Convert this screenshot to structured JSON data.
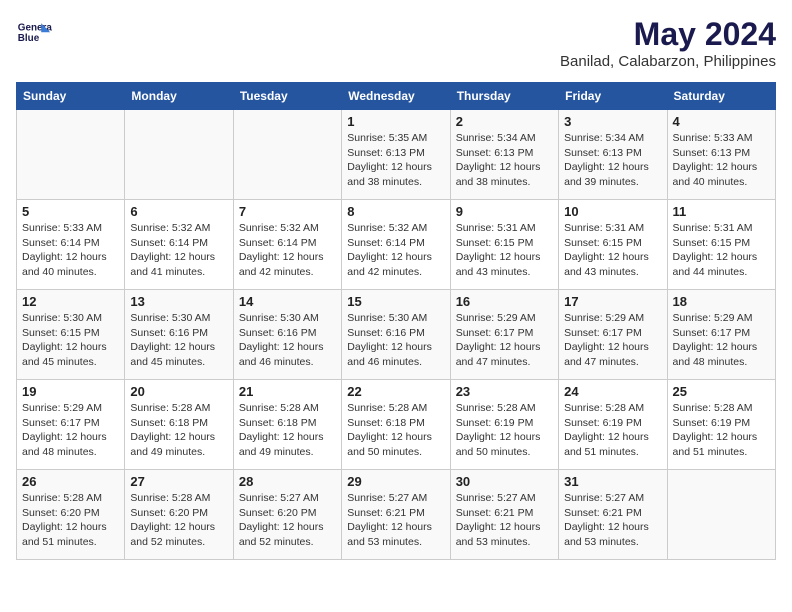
{
  "logo": {
    "line1": "General",
    "line2": "Blue"
  },
  "title": "May 2024",
  "subtitle": "Banilad, Calabarzon, Philippines",
  "columns": [
    "Sunday",
    "Monday",
    "Tuesday",
    "Wednesday",
    "Thursday",
    "Friday",
    "Saturday"
  ],
  "weeks": [
    [
      {
        "day": "",
        "info": ""
      },
      {
        "day": "",
        "info": ""
      },
      {
        "day": "",
        "info": ""
      },
      {
        "day": "1",
        "info": "Sunrise: 5:35 AM\nSunset: 6:13 PM\nDaylight: 12 hours\nand 38 minutes."
      },
      {
        "day": "2",
        "info": "Sunrise: 5:34 AM\nSunset: 6:13 PM\nDaylight: 12 hours\nand 38 minutes."
      },
      {
        "day": "3",
        "info": "Sunrise: 5:34 AM\nSunset: 6:13 PM\nDaylight: 12 hours\nand 39 minutes."
      },
      {
        "day": "4",
        "info": "Sunrise: 5:33 AM\nSunset: 6:13 PM\nDaylight: 12 hours\nand 40 minutes."
      }
    ],
    [
      {
        "day": "5",
        "info": "Sunrise: 5:33 AM\nSunset: 6:14 PM\nDaylight: 12 hours\nand 40 minutes."
      },
      {
        "day": "6",
        "info": "Sunrise: 5:32 AM\nSunset: 6:14 PM\nDaylight: 12 hours\nand 41 minutes."
      },
      {
        "day": "7",
        "info": "Sunrise: 5:32 AM\nSunset: 6:14 PM\nDaylight: 12 hours\nand 42 minutes."
      },
      {
        "day": "8",
        "info": "Sunrise: 5:32 AM\nSunset: 6:14 PM\nDaylight: 12 hours\nand 42 minutes."
      },
      {
        "day": "9",
        "info": "Sunrise: 5:31 AM\nSunset: 6:15 PM\nDaylight: 12 hours\nand 43 minutes."
      },
      {
        "day": "10",
        "info": "Sunrise: 5:31 AM\nSunset: 6:15 PM\nDaylight: 12 hours\nand 43 minutes."
      },
      {
        "day": "11",
        "info": "Sunrise: 5:31 AM\nSunset: 6:15 PM\nDaylight: 12 hours\nand 44 minutes."
      }
    ],
    [
      {
        "day": "12",
        "info": "Sunrise: 5:30 AM\nSunset: 6:15 PM\nDaylight: 12 hours\nand 45 minutes."
      },
      {
        "day": "13",
        "info": "Sunrise: 5:30 AM\nSunset: 6:16 PM\nDaylight: 12 hours\nand 45 minutes."
      },
      {
        "day": "14",
        "info": "Sunrise: 5:30 AM\nSunset: 6:16 PM\nDaylight: 12 hours\nand 46 minutes."
      },
      {
        "day": "15",
        "info": "Sunrise: 5:30 AM\nSunset: 6:16 PM\nDaylight: 12 hours\nand 46 minutes."
      },
      {
        "day": "16",
        "info": "Sunrise: 5:29 AM\nSunset: 6:17 PM\nDaylight: 12 hours\nand 47 minutes."
      },
      {
        "day": "17",
        "info": "Sunrise: 5:29 AM\nSunset: 6:17 PM\nDaylight: 12 hours\nand 47 minutes."
      },
      {
        "day": "18",
        "info": "Sunrise: 5:29 AM\nSunset: 6:17 PM\nDaylight: 12 hours\nand 48 minutes."
      }
    ],
    [
      {
        "day": "19",
        "info": "Sunrise: 5:29 AM\nSunset: 6:17 PM\nDaylight: 12 hours\nand 48 minutes."
      },
      {
        "day": "20",
        "info": "Sunrise: 5:28 AM\nSunset: 6:18 PM\nDaylight: 12 hours\nand 49 minutes."
      },
      {
        "day": "21",
        "info": "Sunrise: 5:28 AM\nSunset: 6:18 PM\nDaylight: 12 hours\nand 49 minutes."
      },
      {
        "day": "22",
        "info": "Sunrise: 5:28 AM\nSunset: 6:18 PM\nDaylight: 12 hours\nand 50 minutes."
      },
      {
        "day": "23",
        "info": "Sunrise: 5:28 AM\nSunset: 6:19 PM\nDaylight: 12 hours\nand 50 minutes."
      },
      {
        "day": "24",
        "info": "Sunrise: 5:28 AM\nSunset: 6:19 PM\nDaylight: 12 hours\nand 51 minutes."
      },
      {
        "day": "25",
        "info": "Sunrise: 5:28 AM\nSunset: 6:19 PM\nDaylight: 12 hours\nand 51 minutes."
      }
    ],
    [
      {
        "day": "26",
        "info": "Sunrise: 5:28 AM\nSunset: 6:20 PM\nDaylight: 12 hours\nand 51 minutes."
      },
      {
        "day": "27",
        "info": "Sunrise: 5:28 AM\nSunset: 6:20 PM\nDaylight: 12 hours\nand 52 minutes."
      },
      {
        "day": "28",
        "info": "Sunrise: 5:27 AM\nSunset: 6:20 PM\nDaylight: 12 hours\nand 52 minutes."
      },
      {
        "day": "29",
        "info": "Sunrise: 5:27 AM\nSunset: 6:21 PM\nDaylight: 12 hours\nand 53 minutes."
      },
      {
        "day": "30",
        "info": "Sunrise: 5:27 AM\nSunset: 6:21 PM\nDaylight: 12 hours\nand 53 minutes."
      },
      {
        "day": "31",
        "info": "Sunrise: 5:27 AM\nSunset: 6:21 PM\nDaylight: 12 hours\nand 53 minutes."
      },
      {
        "day": "",
        "info": ""
      }
    ]
  ]
}
